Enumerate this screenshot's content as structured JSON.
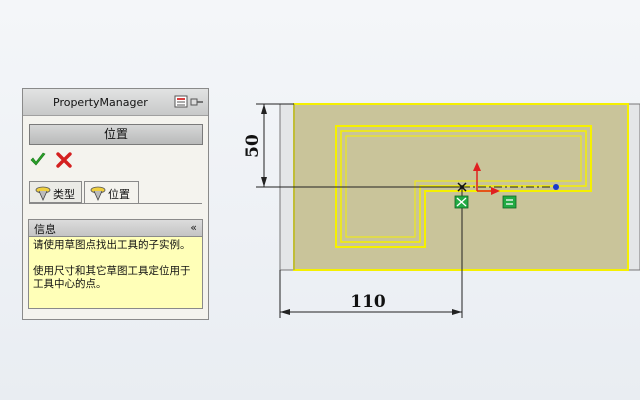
{
  "property_manager": {
    "title": "PropertyManager",
    "section_title": "位置",
    "ok_icon": "check-icon",
    "cancel_icon": "x-icon",
    "tabs": [
      {
        "label": "类型",
        "icon": "hole-wizard-type-icon",
        "active": false
      },
      {
        "label": "位置",
        "icon": "hole-wizard-position-icon",
        "active": true
      }
    ],
    "info": {
      "title": "信息",
      "collapse_glyph": "«",
      "paragraph1": "请使用草图点找出工具的子实例。",
      "paragraph2": "使用尺寸和其它草图工具定位用于工具中心的点。"
    }
  },
  "sketch": {
    "dimension_height": "50",
    "dimension_width": "110"
  },
  "colors": {
    "face_fill": "#c9c49a",
    "selection_yellow": "#f5f000",
    "origin_red": "#e02020",
    "relation_green": "#22aa44",
    "point_blue": "#1a3acc"
  }
}
